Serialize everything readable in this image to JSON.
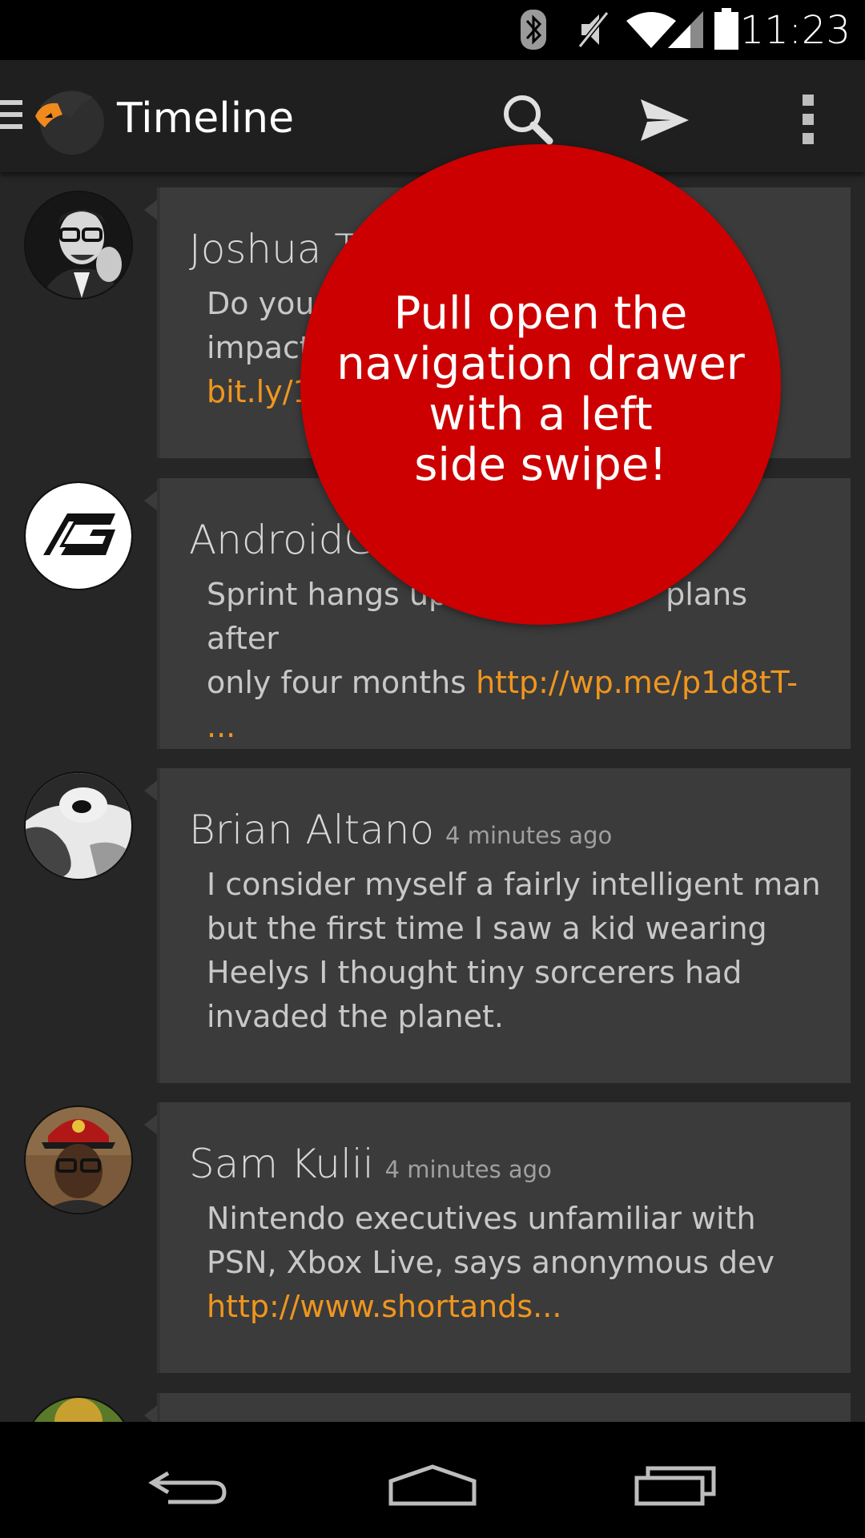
{
  "status_bar": {
    "time": "11:23",
    "icons": [
      "bluetooth-icon",
      "mute-icon",
      "wifi-icon",
      "signal-icon",
      "battery-icon"
    ]
  },
  "action_bar": {
    "title": "Timeline",
    "actions": [
      "search-icon",
      "send-icon",
      "overflow-menu-icon"
    ]
  },
  "hint": {
    "text": "Pull open the\nnavigation drawer\nwith a left\nside swipe!",
    "color": "#cc0000"
  },
  "tweets": [
    {
      "name": "Joshua T",
      "time": "",
      "text": "Do you",
      "text2": "impact",
      "link": "bit.ly/1"
    },
    {
      "name": "AndroidGu",
      "time": "",
      "text": "Sprint hangs up",
      "text_b": "plans after",
      "text2": "only four months ",
      "link": "http://wp.me/p1d8tT-",
      "link2": "..."
    },
    {
      "name": "Brian Altano",
      "time": "4 minutes ago",
      "text": "I consider myself a fairly intelligent man but the first time I saw a kid wearing Heelys I thought tiny sorcerers had invaded the planet."
    },
    {
      "name": "Sam Kulii",
      "time": "4 minutes ago",
      "text": "Nintendo executives unfamiliar with PSN, Xbox Live, says anonymous dev",
      "link": "http://www.shortands..."
    }
  ],
  "colors": {
    "link": "#f0961e",
    "card": "#3b3b3b",
    "background": "#262626",
    "action_bar": "#1f1f1f"
  },
  "nav_bar": {
    "buttons": [
      "back-icon",
      "home-icon",
      "recent-apps-icon"
    ]
  }
}
